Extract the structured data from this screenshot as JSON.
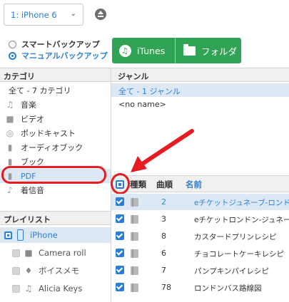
{
  "device": {
    "selected": "1: iPhone 6",
    "arrow": "⌄"
  },
  "mode": {
    "smart_label": "スマートバックアップ",
    "manual_label": "マニュアルバックアップ"
  },
  "actions": {
    "itunes_label": "iTunes",
    "folder_label": "フォルダ"
  },
  "category": {
    "header": "カテゴリ",
    "all_label": "全て - 7 カテゴリ",
    "items": [
      {
        "label": "音楽",
        "icon": "music-note-icon"
      },
      {
        "label": "ビデオ",
        "icon": "video-camera-icon"
      },
      {
        "label": "ポッドキャスト",
        "icon": "podcast-icon"
      },
      {
        "label": "オーディオブック",
        "icon": "audiobook-icon"
      },
      {
        "label": "ブック",
        "icon": "book-icon"
      },
      {
        "label": "PDF",
        "icon": "pdf-icon"
      },
      {
        "label": "着信音",
        "icon": "ringtone-icon"
      }
    ]
  },
  "playlist": {
    "header": "プレイリスト",
    "items": [
      {
        "label": "iPhone",
        "icon": "phone-icon"
      },
      {
        "label": "Camera roll",
        "icon": "video-camera-icon"
      },
      {
        "label": "ボイスメモ",
        "icon": "microphone-icon"
      },
      {
        "label": "Alicia Keys",
        "icon": "music-list-icon"
      }
    ]
  },
  "genre": {
    "header": "ジャンル",
    "items": [
      "全て - 1 ジャンル",
      "<no name>"
    ]
  },
  "table": {
    "columns": {
      "type": "種類",
      "order": "曲順",
      "name": "名前"
    },
    "rows": [
      {
        "order": "2",
        "name": "eチケットジュネーブ-ロンドン"
      },
      {
        "order": "3",
        "name": "eチケットロンドン-ジュネーブ"
      },
      {
        "order": "8",
        "name": "カスタードプリンレシピ"
      },
      {
        "order": "6",
        "name": "チョコレートケーキレシピ"
      },
      {
        "order": "7",
        "name": "パンプキンパイレシピ"
      },
      {
        "order": "78",
        "name": "ロンドンバス路線図"
      }
    ]
  },
  "colors": {
    "accent": "#2a7fd4",
    "green": "#31a354",
    "annotation_red": "#e51c23",
    "selection": "#dde8f5"
  }
}
